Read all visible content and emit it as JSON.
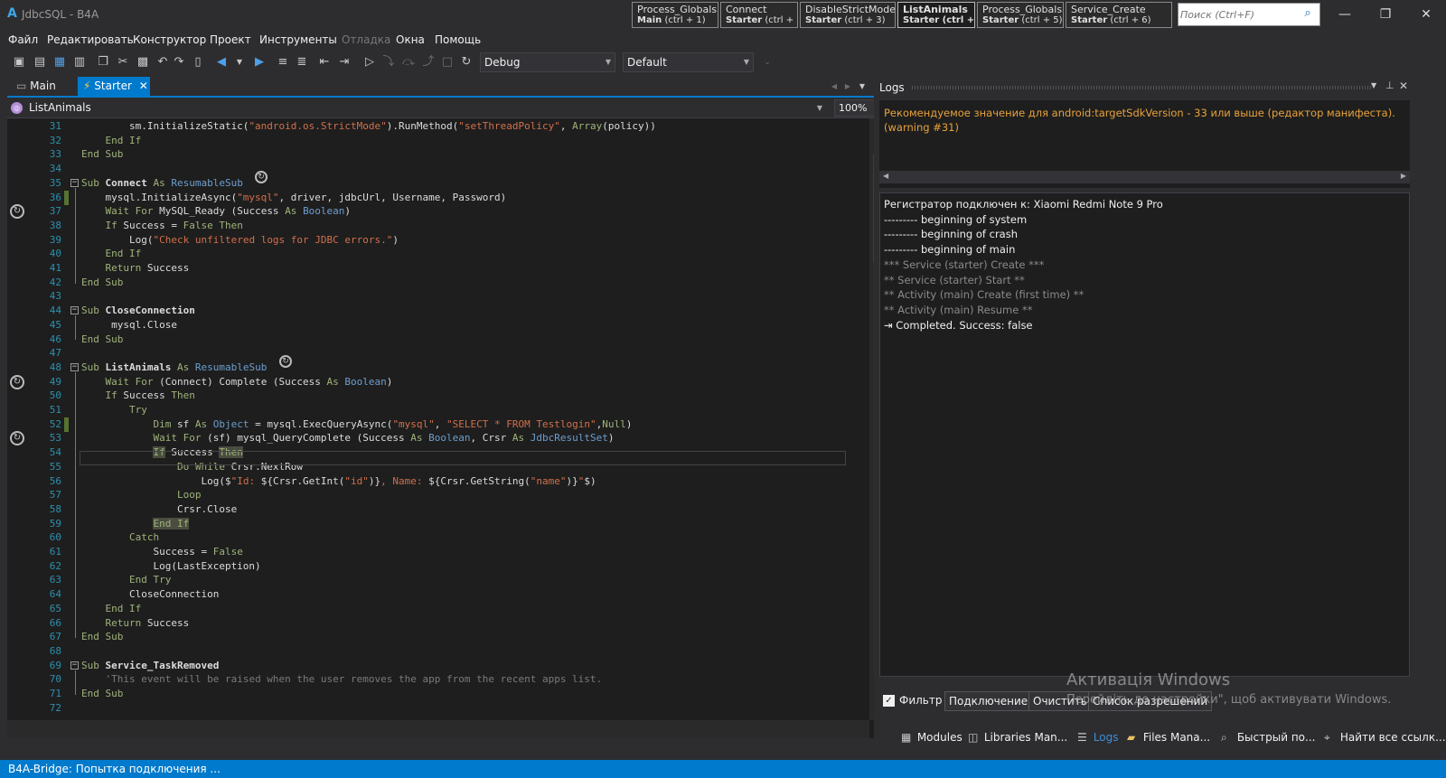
{
  "window": {
    "logo": "A",
    "title": "JdbcSQL - B4A",
    "controls": [
      "—",
      "❐",
      "✕"
    ]
  },
  "quick_tabs": [
    {
      "name": "Process_Globals",
      "module": "Main",
      "shortcut": "(ctrl + 1)",
      "active": false
    },
    {
      "name": "Connect",
      "module": "Starter",
      "shortcut": "(ctrl + 2)",
      "active": false
    },
    {
      "name": "DisableStrictMode",
      "module": "Starter",
      "shortcut": "(ctrl + 3)",
      "active": false
    },
    {
      "name": "ListAnimals",
      "module": "Starter",
      "shortcut": "(ctrl + 4)",
      "active": true
    },
    {
      "name": "Process_Globals",
      "module": "Starter",
      "shortcut": "(ctrl + 5)",
      "active": false
    },
    {
      "name": "Service_Create",
      "module": "Starter",
      "shortcut": "(ctrl + 6)",
      "active": false
    }
  ],
  "search": {
    "placeholder": "Поиск (Ctrl+F)"
  },
  "menu": [
    "Файл",
    "Редактировать",
    "Конструктор",
    "Проект",
    "Инструменты",
    "Отладка",
    "Окна",
    "Помощь"
  ],
  "toolbar": {
    "build_config": "Debug",
    "target": "Default"
  },
  "doc_tabs": {
    "main": "Main",
    "starter": "Starter",
    "close": "✕"
  },
  "editor": {
    "sub_name": "ListAnimals",
    "zoom": "100%",
    "code_lines": [
      {
        "n": "31",
        "html": "        sm.InitializeStatic(<span class='str'>\"android.os.StrictMode\"</span>).RunMethod(<span class='str'>\"setThreadPolicy\"</span>, <span class='kw'>Array</span>(policy))"
      },
      {
        "n": "32",
        "html": "    <span class='kw'>End If</span>"
      },
      {
        "n": "33",
        "html": "<span class='kw'>End Sub</span>"
      },
      {
        "n": "34",
        "html": ""
      },
      {
        "n": "35",
        "html": "<span class='kw'>Sub</span> <b>Connect</b> <span class='kw'>As</span> <span class='typ'>ResumableSub</span>"
      },
      {
        "n": "36",
        "html": "    mysql.InitializeAsync(<span class='str'>\"mysql\"</span>, driver, jdbcUrl, Username, Password)"
      },
      {
        "n": "37",
        "html": "    <span class='kw'>Wait For</span> MySQL_Ready (Success <span class='kw'>As</span> <span class='typ'>Boolean</span>)"
      },
      {
        "n": "38",
        "html": "    <span class='kw'>If</span> Success = <span class='kw'>False</span> <span class='kw'>Then</span>"
      },
      {
        "n": "39",
        "html": "        Log(<span class='str'>\"Check unfiltered logs for JDBC errors.\"</span>)"
      },
      {
        "n": "40",
        "html": "    <span class='kw'>End If</span>"
      },
      {
        "n": "41",
        "html": "    <span class='kw'>Return</span> Success"
      },
      {
        "n": "42",
        "html": "<span class='kw'>End Sub</span>"
      },
      {
        "n": "43",
        "html": ""
      },
      {
        "n": "44",
        "html": "<span class='kw'>Sub</span> <b>CloseConnection</b>"
      },
      {
        "n": "45",
        "html": "     mysql.Close"
      },
      {
        "n": "46",
        "html": "<span class='kw'>End Sub</span>"
      },
      {
        "n": "47",
        "html": ""
      },
      {
        "n": "48",
        "html": "<span class='kw'>Sub</span> <b>ListAnimals</b> <span class='kw'>As</span> <span class='typ'>ResumableSub</span>"
      },
      {
        "n": "49",
        "html": "    <span class='kw'>Wait For</span> (Connect) Complete (Success <span class='kw'>As</span> <span class='typ'>Boolean</span>)"
      },
      {
        "n": "50",
        "html": "    <span class='kw'>If</span> Success <span class='kw'>Then</span>"
      },
      {
        "n": "51",
        "html": "        <span class='kw'>Try</span>"
      },
      {
        "n": "52",
        "html": "            <span class='kw'>Dim</span> sf <span class='kw'>As</span> <span class='typ'>Object</span> = mysql.ExecQueryAsync(<span class='str'>\"mysql\"</span>, <span class='str'>\"SELECT * FROM Testlogin\"</span>,<span class='kw'>Null</span>)"
      },
      {
        "n": "53",
        "html": "            <span class='kw'>Wait For</span> (sf) mysql_QueryComplete (Success <span class='kw'>As</span> <span class='typ'>Boolean</span>, Crsr <span class='kw'>As</span> <span class='typ'>JdbcResultSet</span>)"
      },
      {
        "n": "54",
        "html": "            <span class='kw hl'>If</span> Success <span class='kw hl'>Then</span>"
      },
      {
        "n": "55",
        "html": "                <span class='kw'>Do While</span> Crsr.NextRow"
      },
      {
        "n": "56",
        "html": "                    Log($<span class='str'>\"Id: </span>${Crsr.GetInt(<span class='str'>\"id\"</span>)}<span class='str'>, Name: </span>${Crsr.GetString(<span class='str'>\"name\"</span>)}<span class='str'>\"</span>$)"
      },
      {
        "n": "57",
        "html": "                <span class='kw'>Loop</span>"
      },
      {
        "n": "58",
        "html": "                Crsr.Close"
      },
      {
        "n": "59",
        "html": "            <span class='kw hl'>End If</span>"
      },
      {
        "n": "60",
        "html": "        <span class='kw'>Catch</span>"
      },
      {
        "n": "61",
        "html": "            Success = <span class='kw'>False</span>"
      },
      {
        "n": "62",
        "html": "            Log(LastException)"
      },
      {
        "n": "63",
        "html": "        <span class='kw'>End Try</span>"
      },
      {
        "n": "64",
        "html": "        CloseConnection"
      },
      {
        "n": "65",
        "html": "    <span class='kw'>End If</span>"
      },
      {
        "n": "66",
        "html": "    <span class='kw'>Return</span> Success"
      },
      {
        "n": "67",
        "html": "<span class='kw'>End Sub</span>"
      },
      {
        "n": "68",
        "html": ""
      },
      {
        "n": "69",
        "html": "<span class='kw'>Sub</span> <b>Service_TaskRemoved</b>"
      },
      {
        "n": "70",
        "html": "    <span class='cmt'>'This event will be raised when the user removes the app from the recent apps list.</span>"
      },
      {
        "n": "71",
        "html": "<span class='kw'>End Sub</span>"
      },
      {
        "n": "72",
        "html": ""
      }
    ]
  },
  "logs": {
    "title": "Logs",
    "warning": "Рекомендуемое значение для android:targetSdkVersion - 33 или выше (редактор манифеста). (warning #31)",
    "lines": [
      {
        "text": "Регистратор подключен к:  Xiaomi Redmi Note 9 Pro",
        "style": "w"
      },
      {
        "text": "--------- beginning of system",
        "style": "w"
      },
      {
        "text": "--------- beginning of crash",
        "style": "w"
      },
      {
        "text": "--------- beginning of main",
        "style": "w"
      },
      {
        "text": "*** Service (starter) Create ***",
        "style": "g"
      },
      {
        "text": "** Service (starter) Start **",
        "style": "g"
      },
      {
        "text": "** Activity (main) Create (first time) **",
        "style": "g"
      },
      {
        "text": "** Activity (main) Resume **",
        "style": "g"
      },
      {
        "text": "Completed. Success: false",
        "style": "w"
      }
    ],
    "filter_label": "Фильтр",
    "connect_btn": "Подключение",
    "clear_btn": "Очистить",
    "perms_btn": "Список разрешений"
  },
  "activation": {
    "title": "Активація Windows",
    "subtitle": "Перейдіть до настройки\", щоб активувати Windows."
  },
  "bottom_tabs": [
    "Modules",
    "Libraries Man...",
    "Logs",
    "Files Mana...",
    "Быстрый по...",
    "Найти все ссылк..."
  ],
  "status": {
    "text": "B4A-Bridge: Попытка подключения ..."
  },
  "colors": {
    "accent": "#007acc",
    "warning": "#e8a23c",
    "background": "#1e1e1e"
  }
}
